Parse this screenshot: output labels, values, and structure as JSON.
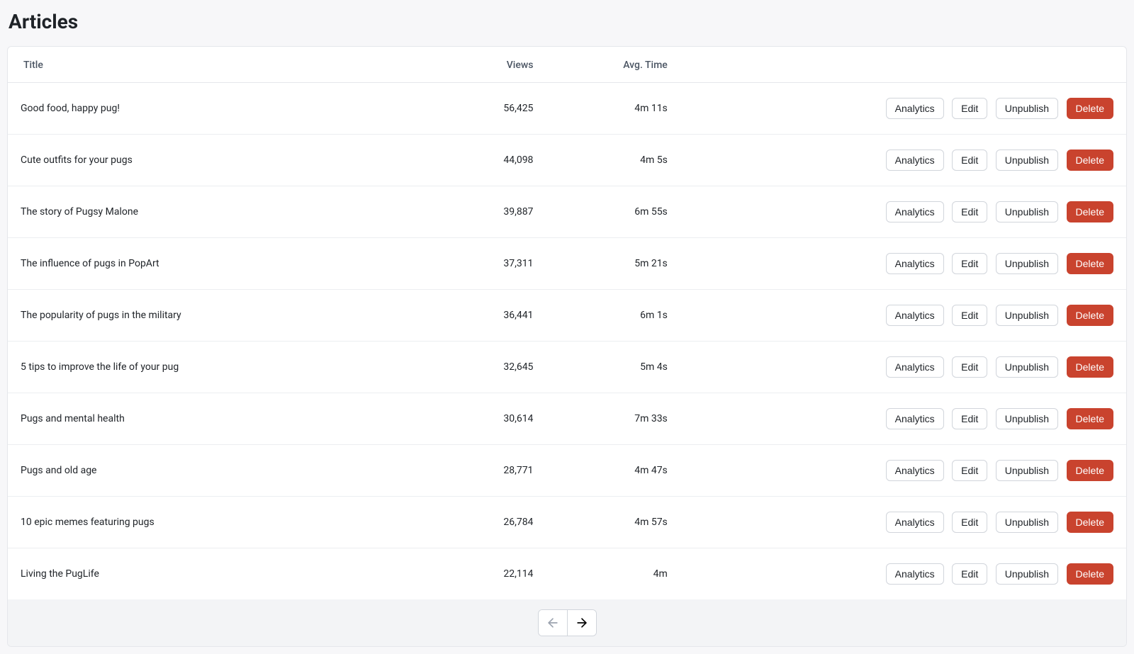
{
  "page": {
    "title": "Articles"
  },
  "table": {
    "headers": {
      "title": "Title",
      "views": "Views",
      "avg_time": "Avg. Time"
    },
    "rows": [
      {
        "title": "Good food, happy pug!",
        "views": "56,425",
        "avg_time": "4m 11s"
      },
      {
        "title": "Cute outfits for your pugs",
        "views": "44,098",
        "avg_time": "4m 5s"
      },
      {
        "title": "The story of Pugsy Malone",
        "views": "39,887",
        "avg_time": "6m 55s"
      },
      {
        "title": "The influence of pugs in PopArt",
        "views": "37,311",
        "avg_time": "5m 21s"
      },
      {
        "title": "The popularity of pugs in the military",
        "views": "36,441",
        "avg_time": "6m 1s"
      },
      {
        "title": "5 tips to improve the life of your pug",
        "views": "32,645",
        "avg_time": "5m 4s"
      },
      {
        "title": "Pugs and mental health",
        "views": "30,614",
        "avg_time": "7m 33s"
      },
      {
        "title": "Pugs and old age",
        "views": "28,771",
        "avg_time": "4m 47s"
      },
      {
        "title": "10 epic memes featuring pugs",
        "views": "26,784",
        "avg_time": "4m 57s"
      },
      {
        "title": "Living the PugLife",
        "views": "22,114",
        "avg_time": "4m"
      }
    ]
  },
  "actions": {
    "analytics": "Analytics",
    "edit": "Edit",
    "unpublish": "Unpublish",
    "delete": "Delete"
  },
  "pagination": {
    "prev_disabled": true,
    "next_disabled": false
  }
}
